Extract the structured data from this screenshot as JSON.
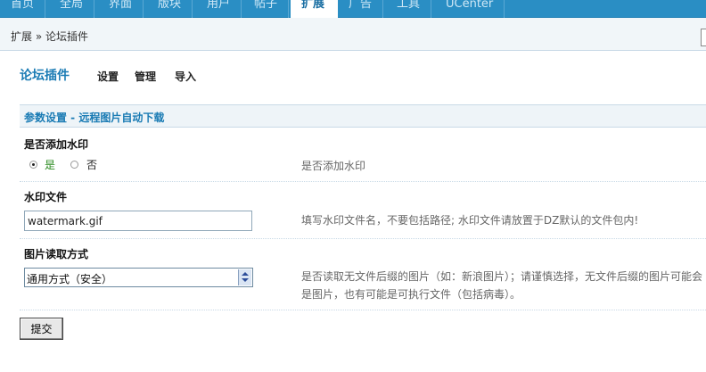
{
  "nav": {
    "tabs": [
      {
        "label": "首页"
      },
      {
        "label": "全局"
      },
      {
        "label": "界面"
      },
      {
        "label": "版块"
      },
      {
        "label": "用户"
      },
      {
        "label": "帖子"
      },
      {
        "label": "扩展",
        "active": true
      },
      {
        "label": "广告"
      },
      {
        "label": "工具"
      },
      {
        "label": "UCenter"
      }
    ]
  },
  "breadcrumb": "扩展 » 论坛插件",
  "subnav": {
    "title": "论坛插件",
    "links": [
      "设置",
      "管理",
      "导入"
    ]
  },
  "section": {
    "title": "参数设置 - 远程图片自动下载"
  },
  "form": {
    "watermark": {
      "label": "是否添加水印",
      "options": [
        "是",
        "否"
      ],
      "selected": "是",
      "hint": "是否添加水印"
    },
    "watermark_file": {
      "label": "水印文件",
      "value": "watermark.gif",
      "hint": "填写水印文件名，不要包括路径; 水印文件请放置于DZ默认的文件包内!"
    },
    "read_mode": {
      "label": "图片读取方式",
      "selected": "通用方式（安全）",
      "hint_line1": "是否读取无文件后缀的图片（如：新浪图片）；请谨慎选择，无文件后缀的图片可能会",
      "hint_line2": "是图片，也有可能是可执行文件（包括病毒）。"
    },
    "submit_label": "提交"
  }
}
